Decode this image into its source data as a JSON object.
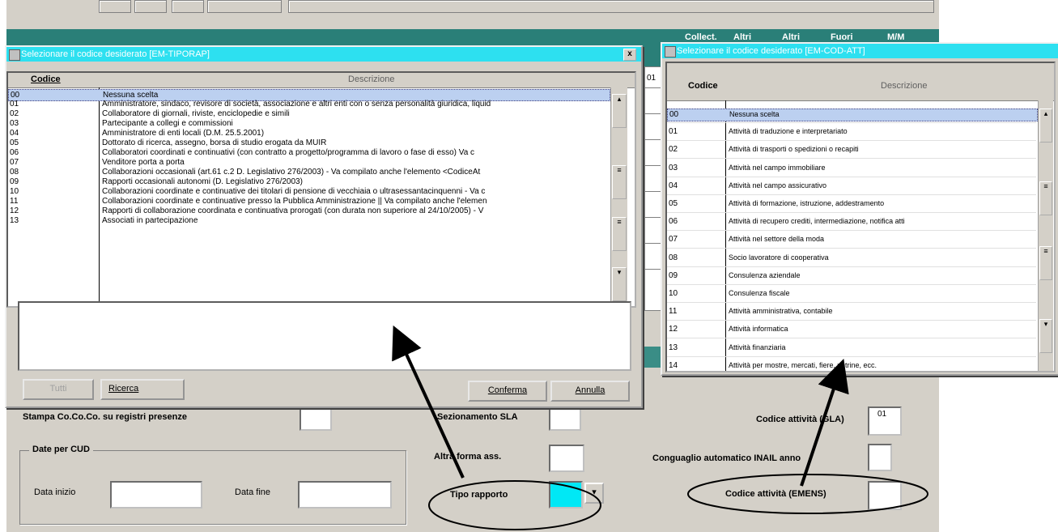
{
  "background_window": {
    "header_right_cells": [
      "Collect.",
      "Altri",
      "Altri",
      "Fuori",
      "M/M"
    ],
    "stampa_label": "Stampa Co.Co.Co. su registri presenze",
    "dati_cud": {
      "title": "Date per CUD",
      "data_inizio_label": "Data inizio",
      "data_fine_label": "Data fine"
    },
    "right_labels": {
      "sezione_sla": "Sezionamento SLA",
      "altra_forma": "Altra forma ass.",
      "tipo_rapporto": "Tipo rapporto",
      "codice_attivita_gla": "Codice attività (GLA)",
      "codice_attivita_gla_value": "01",
      "conguaglio": "Conguaglio automatico INAIL anno",
      "codice_attivita_emens": "Codice attività (EMENS)"
    },
    "list_behind_value": "01"
  },
  "dialog_left": {
    "title": "Selezionare il codice desiderato    [EM-TIPORAP]",
    "close": "x",
    "col_codice": "Codice",
    "col_descrizione": "Descrizione",
    "rows": [
      {
        "code": "00",
        "desc": "Nessuna scelta"
      },
      {
        "code": "01",
        "desc": "Amministratore, sindaco, revisore di società, associazione e altri enti con o senza personalità giuridica, liquid"
      },
      {
        "code": "02",
        "desc": "Collaboratore di giornali, riviste, enciclopedie e simili"
      },
      {
        "code": "03",
        "desc": "Partecipante a collegi e commissioni"
      },
      {
        "code": "04",
        "desc": "Amministratore di enti locali (D.M. 25.5.2001)"
      },
      {
        "code": "05",
        "desc": "Dottorato di ricerca, assegno, borsa di studio erogata da MUIR"
      },
      {
        "code": "06",
        "desc": "Collaboratori coordinati e continuativi (con contratto a progetto/programma di lavoro o fase di esso) Va c"
      },
      {
        "code": "07",
        "desc": "Venditore porta a porta"
      },
      {
        "code": "08",
        "desc": "Collaborazioni occasionali (art.61 c.2 D. Legislativo 276/2003) - Va compilato anche l'elemento <CodiceAt"
      },
      {
        "code": "09",
        "desc": "Rapporti occasionali autonomi (D. Legislativo 276/2003)"
      },
      {
        "code": "10",
        "desc": "Collaborazioni coordinate e continuative dei titolari di pensione di vecchiaia o ultrasessantacinquenni - Va c"
      },
      {
        "code": "11",
        "desc": "Collaborazioni coordinate e continuative presso la Pubblica Amministrazione || Va compilato anche l'elemen"
      },
      {
        "code": "12",
        "desc": "Rapporti di collaborazione coordinata e continuativa prorogati (con durata non superiore al 24/10/2005) - V"
      },
      {
        "code": "13",
        "desc": "Associati in partecipazione"
      }
    ],
    "buttons": {
      "tutti": "Tutti",
      "ricerca": "Ricerca",
      "conferma": "Conferma",
      "annulla": "Annulla"
    }
  },
  "dialog_right": {
    "title": "Selezionare il codice desiderato    [EM-COD-ATT]",
    "col_codice": "Codice",
    "col_descrizione": "Descrizione",
    "rows": [
      {
        "code": "00",
        "desc": "Nessuna scelta"
      },
      {
        "code": "01",
        "desc": "Attività di traduzione e interpretariato"
      },
      {
        "code": "02",
        "desc": "Attività di trasporti o spedizioni o recapiti"
      },
      {
        "code": "03",
        "desc": "Attività nel campo immobiliare"
      },
      {
        "code": "04",
        "desc": "Attività nel campo assicurativo"
      },
      {
        "code": "05",
        "desc": "Attività di formazione, istruzione, addestramento"
      },
      {
        "code": "06",
        "desc": "Attività di recupero crediti, intermediazione, notifica atti"
      },
      {
        "code": "07",
        "desc": "Attività nel settore della moda"
      },
      {
        "code": "08",
        "desc": "Socio lavoratore di cooperativa"
      },
      {
        "code": "09",
        "desc": "Consulenza aziendale"
      },
      {
        "code": "10",
        "desc": "Consulenza fiscale"
      },
      {
        "code": "11",
        "desc": "Attività amministrativa, contabile"
      },
      {
        "code": "12",
        "desc": "Attività informatica"
      },
      {
        "code": "13",
        "desc": "Attività finanziaria"
      },
      {
        "code": "14",
        "desc": "Attività per mostre, mercati, fiere, vetrine, ecc."
      }
    ]
  },
  "colors": {
    "titlebar": "#2de0f0",
    "teal": "#2a7f78",
    "dialog_bg": "#d4d0c8",
    "highlight": "#00e8f5"
  }
}
